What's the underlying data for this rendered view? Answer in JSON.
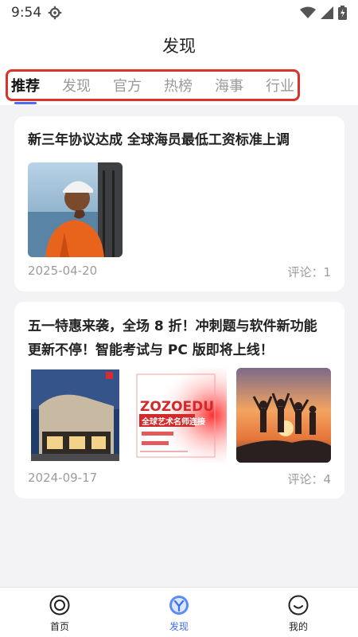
{
  "status_bar": {
    "time": "9:54",
    "icons": [
      "gear-icon",
      "wifi-icon",
      "signal-icon",
      "battery-icon"
    ]
  },
  "header": {
    "title": "发现"
  },
  "tabs": [
    {
      "label": "推荐",
      "active": true
    },
    {
      "label": "发现",
      "active": false
    },
    {
      "label": "官方",
      "active": false
    },
    {
      "label": "热榜",
      "active": false
    },
    {
      "label": "海事",
      "active": false
    },
    {
      "label": "行业",
      "active": false
    }
  ],
  "posts": [
    {
      "title": "新三年协议达成 全球海员最低工资标准上调",
      "date": "2025-04-20",
      "comments": "评论：1",
      "images": [
        "seafarer-photo"
      ]
    },
    {
      "title_line1": "五一特惠来袭，全场 8 折！冲刺题与软件新功能",
      "title_line2": "更新不停！智能考试与 PC 版即将上线！",
      "date": "2024-09-17",
      "comments": "评论：4",
      "images": [
        "building-photo",
        "poster-image",
        "people-sunset-photo"
      ],
      "poster_text": {
        "brand": "ZOZOEDU",
        "headline": "全球艺术名师连接"
      }
    }
  ],
  "bottom_nav": [
    {
      "label": "首页",
      "icon": "home-ring-icon",
      "active": false
    },
    {
      "label": "发现",
      "icon": "discover-icon",
      "active": true
    },
    {
      "label": "我的",
      "icon": "profile-smile-icon",
      "active": false
    }
  ],
  "colors": {
    "accent": "#3d6df0",
    "highlight_outline": "#d9342b",
    "background": "#f3f3f5"
  }
}
